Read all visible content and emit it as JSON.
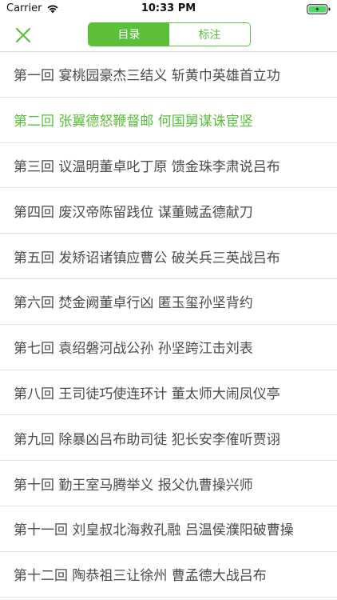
{
  "status_bar": {
    "carrier": "Carrier",
    "time": "10:33 PM"
  },
  "nav": {
    "close_icon": "close-x-icon",
    "tabs": [
      {
        "label": "目录",
        "active": true
      },
      {
        "label": "标注",
        "active": false
      }
    ]
  },
  "colors": {
    "accent": "#5bbf3a",
    "text": "#4a4a4a",
    "divider": "#e4e4e4"
  },
  "chapters": [
    {
      "label": "第一回 宴桃园豪杰三结义 斩黄巾英雄首立功",
      "current": false
    },
    {
      "label": "第二回 张翼德怒鞭督邮 何国舅谋诛宦竖",
      "current": true
    },
    {
      "label": "第三回 议温明董卓叱丁原 馈金珠李肃说吕布",
      "current": false
    },
    {
      "label": "第四回 废汉帝陈留践位 谋董贼孟德献刀",
      "current": false
    },
    {
      "label": "第五回 发矫诏诸镇应曹公 破关兵三英战吕布",
      "current": false
    },
    {
      "label": "第六回 焚金阙董卓行凶 匿玉玺孙坚背约",
      "current": false
    },
    {
      "label": "第七回 袁绍磐河战公孙 孙坚跨江击刘表",
      "current": false
    },
    {
      "label": "第八回 王司徒巧使连环计 董太师大闹凤仪亭",
      "current": false
    },
    {
      "label": "第九回 除暴凶吕布助司徒 犯长安李傕听贾诩",
      "current": false
    },
    {
      "label": "第十回 勤王室马腾举义 报父仇曹操兴师",
      "current": false
    },
    {
      "label": "第十一回 刘皇叔北海救孔融 吕温侯濮阳破曹操",
      "current": false
    },
    {
      "label": "第十二回 陶恭祖三让徐州 曹孟德大战吕布",
      "current": false
    }
  ]
}
